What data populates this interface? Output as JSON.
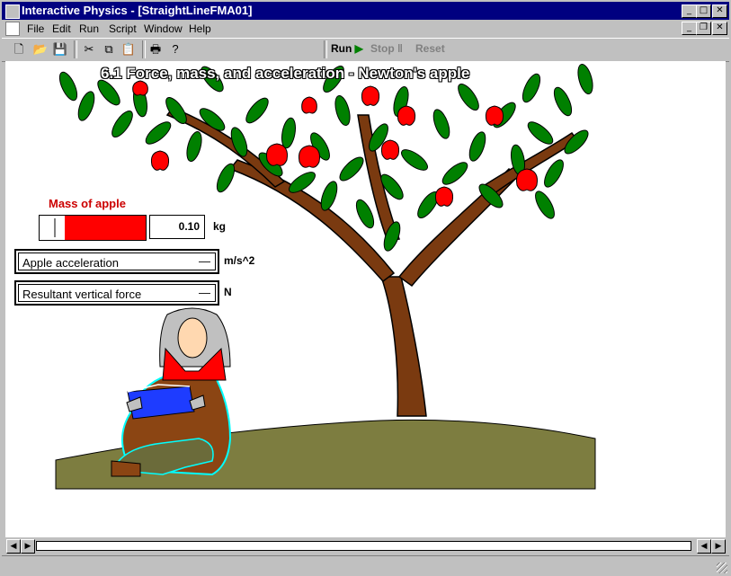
{
  "window": {
    "title": "Interactive Physics - [StraightLineFMA01]"
  },
  "menubar": {
    "file": "File",
    "edit": "Edit",
    "run": "Run",
    "script": "Script",
    "window": "Window",
    "help": "Help"
  },
  "toolbar": {
    "run_label": "Run",
    "stop_label": "Stop",
    "reset_label": "Reset"
  },
  "canvas": {
    "heading": "6.1 Force, mass, and acceleration - Newton's apple",
    "mass_label": "Mass of apple",
    "mass_value": "0.10",
    "mass_unit": "kg",
    "mass_slider_fraction": 0.24,
    "accel_label": "Apple acceleration",
    "accel_value": "—",
    "accel_unit": "m/s^2",
    "force_label": "Resultant vertical force",
    "force_value": "—",
    "force_unit": "N"
  },
  "colors": {
    "titlebar": "#000080",
    "chrome": "#c0c0c0",
    "slider_fill": "#ff0000",
    "label_red": "#cc0000",
    "leaf": "#008000",
    "trunk": "#7a3a10",
    "ground": "#7d7d40",
    "apple": "#ff0000",
    "book": "#1e3cff"
  }
}
